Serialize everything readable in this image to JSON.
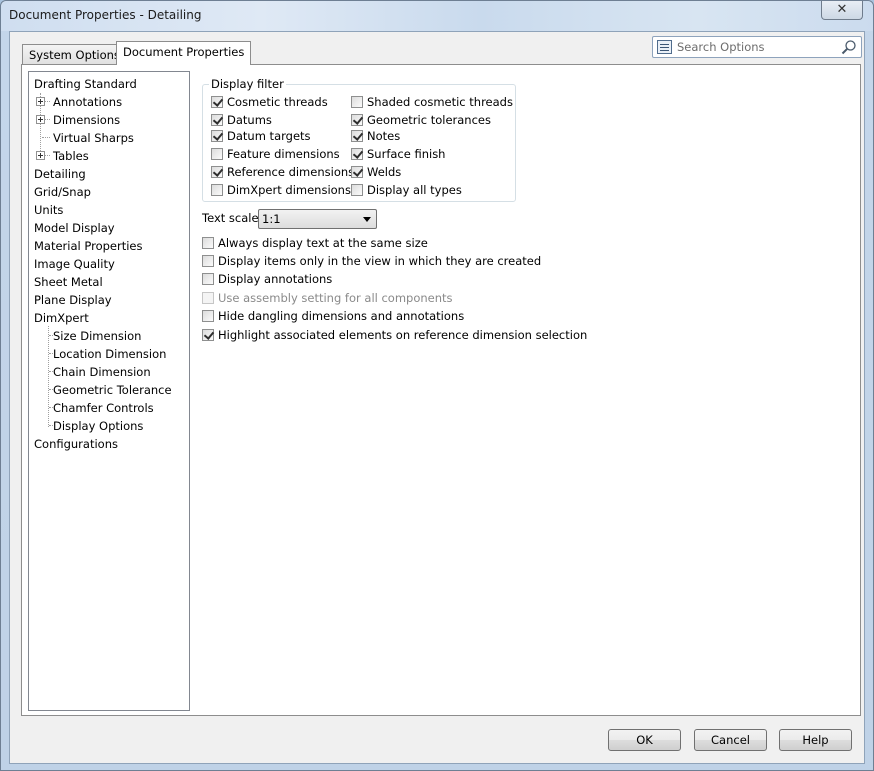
{
  "window": {
    "title": "Document Properties - Detailing",
    "close_glyph": "✕"
  },
  "tabs": [
    {
      "label": "System Options",
      "active": false
    },
    {
      "label": "Document Properties",
      "active": true
    }
  ],
  "search": {
    "placeholder": "Search Options"
  },
  "tree": {
    "selected": "Detailing",
    "items": [
      {
        "label": "Drafting Standard",
        "level": 0
      },
      {
        "label": "Annotations",
        "level": 1,
        "expandable": true
      },
      {
        "label": "Dimensions",
        "level": 1,
        "expandable": true
      },
      {
        "label": "Virtual Sharps",
        "level": 1
      },
      {
        "label": "Tables",
        "level": 1,
        "expandable": true
      },
      {
        "label": "Detailing",
        "level": 0
      },
      {
        "label": "Grid/Snap",
        "level": 0
      },
      {
        "label": "Units",
        "level": 0
      },
      {
        "label": "Model Display",
        "level": 0
      },
      {
        "label": "Material Properties",
        "level": 0
      },
      {
        "label": "Image Quality",
        "level": 0
      },
      {
        "label": "Sheet Metal",
        "level": 0
      },
      {
        "label": "Plane Display",
        "level": 0
      },
      {
        "label": "DimXpert",
        "level": 0
      },
      {
        "label": "Size Dimension",
        "level": 1
      },
      {
        "label": "Location Dimension",
        "level": 1
      },
      {
        "label": "Chain Dimension",
        "level": 1
      },
      {
        "label": "Geometric Tolerance",
        "level": 1
      },
      {
        "label": "Chamfer Controls",
        "level": 1
      },
      {
        "label": "Display Options",
        "level": 1
      },
      {
        "label": "Configurations",
        "level": 0
      }
    ]
  },
  "display_filter": {
    "legend": "Display filter",
    "left": [
      {
        "label": "Cosmetic threads",
        "checked": true
      },
      {
        "label": "Datums",
        "checked": true
      },
      {
        "label": "Datum targets",
        "checked": true
      },
      {
        "label": "Feature dimensions",
        "checked": false
      },
      {
        "label": "Reference dimensions",
        "checked": true
      },
      {
        "label": "DimXpert dimensions",
        "checked": false
      }
    ],
    "right": [
      {
        "label": "Shaded cosmetic threads",
        "checked": false
      },
      {
        "label": "Geometric tolerances",
        "checked": true
      },
      {
        "label": "Notes",
        "checked": true
      },
      {
        "label": "Surface finish",
        "checked": true
      },
      {
        "label": "Welds",
        "checked": true
      },
      {
        "label": "Display all types",
        "checked": false
      }
    ]
  },
  "text_scale": {
    "label": "Text scale:",
    "value": "1:1"
  },
  "options": [
    {
      "label": "Always display text at the same size",
      "checked": false,
      "disabled": false
    },
    {
      "label": "Display items only in the view in which they are created",
      "checked": false,
      "disabled": false
    },
    {
      "label": "Display annotations",
      "checked": false,
      "disabled": false
    },
    {
      "label": "Use assembly setting for all components",
      "checked": false,
      "disabled": true
    },
    {
      "label": "Hide dangling dimensions and annotations",
      "checked": false,
      "disabled": false
    },
    {
      "label": "Highlight associated elements on reference dimension selection",
      "checked": true,
      "disabled": false
    }
  ],
  "buttons": {
    "ok": "OK",
    "cancel": "Cancel",
    "help": "Help"
  }
}
